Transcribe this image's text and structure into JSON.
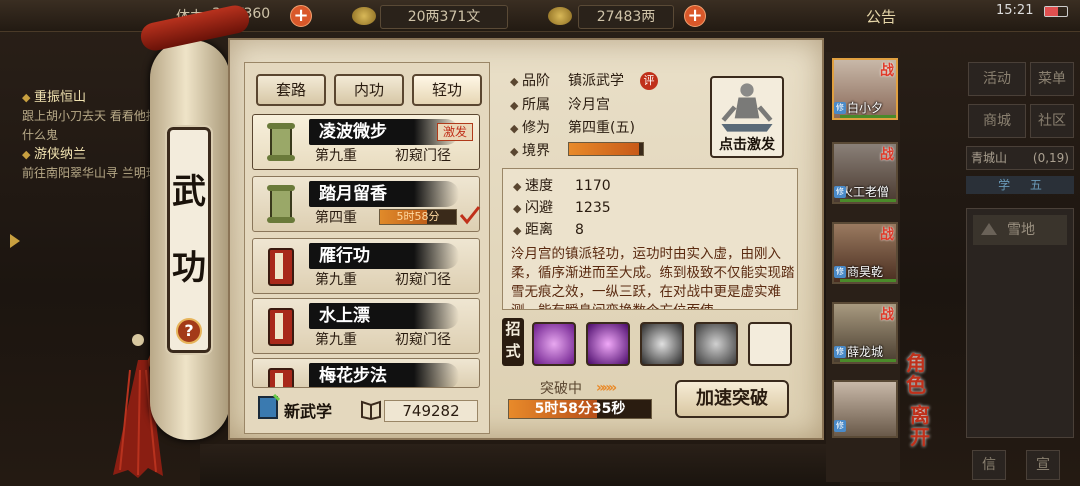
{
  "topbar": {
    "stamina_label": "体力",
    "stamina_value": "309/360",
    "silver_value": "20两371文",
    "gold_value": "27483两",
    "announcement": "公告",
    "clock": "15:21"
  },
  "quests": [
    {
      "title": "重振恒山",
      "desc": "跟上胡小刀去天 看看他搞什么鬼"
    },
    {
      "title": "游侠纳兰",
      "desc": "前往南阳翠华山寻 兰明珠"
    }
  ],
  "side_menu": {
    "buttons": [
      "活动",
      "菜单",
      "商城",
      "社区"
    ],
    "location": "青城山",
    "coords": "(0,19)",
    "tabs": [
      "学",
      "五"
    ],
    "terrain": "雪地",
    "bottom": [
      "信",
      "宣"
    ]
  },
  "scroll": {
    "title_top": "武",
    "title_bottom": "功",
    "help": "?"
  },
  "tabs": [
    "套路",
    "内功",
    "轻功"
  ],
  "skills": [
    {
      "name": "凌波微步",
      "level": "第九重",
      "stage": "初窥门径",
      "badge": "激发"
    },
    {
      "name": "踏月留香",
      "level": "第四重",
      "timer": "5时58分",
      "timer_progress": 0.62
    },
    {
      "name": "雁行功",
      "level": "第九重",
      "stage": "初窥门径"
    },
    {
      "name": "水上漂",
      "level": "第九重",
      "stage": "初窥门径"
    },
    {
      "name": "梅花步法",
      "level": "",
      "stage": ""
    }
  ],
  "new_skill": "新武学",
  "points": "749282",
  "details": {
    "grade_label": "品阶",
    "grade": "镇派武学",
    "grade_badge": "评",
    "sect_label": "所属",
    "sect": "泠月宫",
    "cult_label": "修为",
    "cult": "第四重(五)",
    "realm_label": "境界",
    "realm_progress": 0.95,
    "portrait_caption": "点击激发"
  },
  "stats": [
    {
      "k": "速度",
      "v": "1170"
    },
    {
      "k": "闪避",
      "v": "1235"
    },
    {
      "k": "距离",
      "v": "8"
    }
  ],
  "description": "泠月宫的镇派轻功，运功时由实入虚，由刚入柔，循序渐进而至大成。练到极致不仅能实现踏雪无痕之效，一纵三跃，在对战中更是虚实难测，能有瞬息间变换数个方位而使",
  "moves_label": "招式",
  "breakthrough": {
    "label": "突破中",
    "time": "5时58分35秒",
    "progress": 0.62
  },
  "speedup_button": "加速突破",
  "characters": [
    {
      "name": "白小夕",
      "zhan": "战",
      "xiu": "修"
    },
    {
      "name": "火工老僧",
      "zhan": "战",
      "xiu": "修"
    },
    {
      "name": "商昊乾",
      "zhan": "战",
      "xiu": "修"
    },
    {
      "name": "薛龙城",
      "zhan": "战",
      "xiu": "修"
    },
    {
      "name": "",
      "zhan": "",
      "xiu": "修"
    }
  ],
  "right_labels": {
    "role": "角色",
    "leave": "离开"
  },
  "colors": {
    "accent": "#c0301a",
    "progress": "#e88a2a",
    "paper": "#e9dfc8"
  }
}
